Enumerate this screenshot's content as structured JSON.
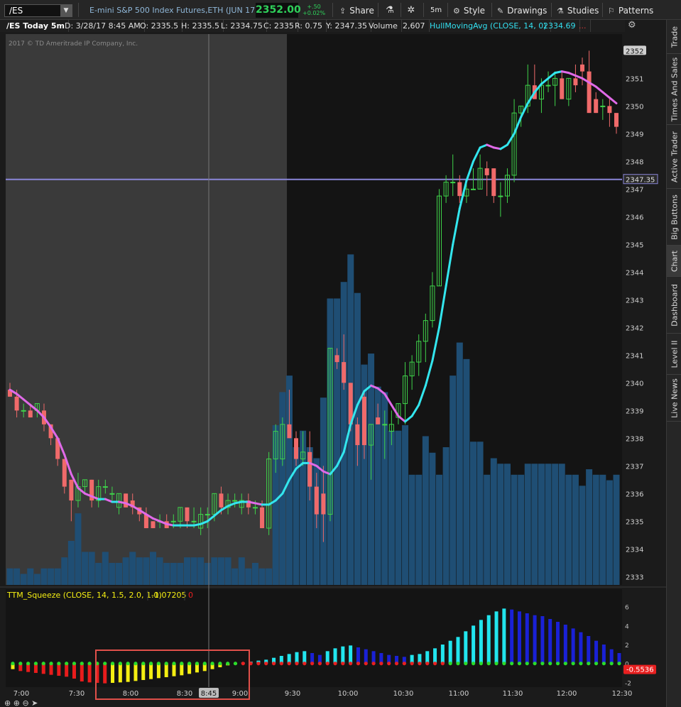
{
  "toolbar": {
    "symbol": "/ES",
    "description": "E-mini S&P 500 Index Futures,ETH (JUN 17)",
    "last_price": "2352.00",
    "change_abs": "+.50",
    "change_pct": "+0.02%",
    "share_label": "Share",
    "interval_label": "5m",
    "style_label": "Style",
    "drawings_label": "Drawings",
    "studies_label": "Studies",
    "patterns_label": "Patterns"
  },
  "infobar": {
    "title": "/ES Today 5m",
    "date": "D: 3/28/17 8:45 AM",
    "open": "O: 2335.5",
    "high": "H: 2335.5",
    "low": "L: 2334.75",
    "close": "C: 2335",
    "range": "R: 0.75",
    "y": "Y: 2347.35",
    "volume_label": "Volume",
    "volume_value": "2,607",
    "study_label": "HullMovingAvg (CLOSE, 14, 0)",
    "study_value": "2334.69",
    "dots": "..."
  },
  "watermark": "2017 © TD Ameritrade IP Company, Inc.",
  "sidebar_tabs": [
    "Trade",
    "Times And Sales",
    "Active Trader",
    "Big Buttons",
    "Chart",
    "Dashboard",
    "Level II",
    "Live News"
  ],
  "active_tab": "Chart",
  "lower_study": {
    "label": "TTM_Squeeze (CLOSE, 14, 1.5, 2.0, 1.0)",
    "value": "-1.07205",
    "extra": "0",
    "last_badge": "-0.5536"
  },
  "crosshair_time": "8:45",
  "price_badges": {
    "top": "2352",
    "horizontal_line": "2347.35"
  },
  "colors": {
    "up_candle": "#3fd34a",
    "down_candle": "#f06a6a",
    "hma_rising": "#33e6ee",
    "hma_falling": "#e06ae8",
    "volume": "#1f4e74",
    "premarket_bg": "#3a3a3a",
    "session_bg": "#141414",
    "h_line": "#8a86d8",
    "squeeze_red": "#e81c1c",
    "squeeze_yellow": "#f4ee12",
    "squeeze_cyan": "#22e5ee",
    "squeeze_blue": "#1a21d6",
    "dot_green": "#2adc2a",
    "dot_red": "#e82020",
    "highlight_box": "#e0504a"
  },
  "chart_data": [
    {
      "type": "candlestick",
      "title": "/ES Today 5m",
      "price_axis_ticks": [
        "2333",
        "2334",
        "2335",
        "2336",
        "2337",
        "2338",
        "2339",
        "2340",
        "2341",
        "2342",
        "2343",
        "2344",
        "2345",
        "2346",
        "2347",
        "2348",
        "2349",
        "2350",
        "2351",
        "2352"
      ],
      "ylim": [
        2332.7,
        2352.6
      ],
      "time_ticks": [
        "7:00",
        "7:30",
        "8:00",
        "8:30",
        "9:00",
        "9:30",
        "10:00",
        "10:30",
        "11:00",
        "11:30",
        "12:00",
        "12:30"
      ],
      "candles": [
        [
          2339.75,
          2340.0,
          2339.5,
          2339.5
        ],
        [
          2339.5,
          2339.75,
          2338.75,
          2339.0
        ],
        [
          2339.0,
          2339.25,
          2338.75,
          2339.0
        ],
        [
          2339.0,
          2339.25,
          2338.75,
          2338.75
        ],
        [
          2339.0,
          2339.25,
          2338.75,
          2339.25
        ],
        [
          2339.0,
          2339.25,
          2338.25,
          2338.5
        ],
        [
          2338.5,
          2338.5,
          2337.75,
          2338.0
        ],
        [
          2338.0,
          2338.0,
          2337.0,
          2337.25
        ],
        [
          2337.25,
          2337.25,
          2336.0,
          2336.25
        ],
        [
          2336.5,
          2336.5,
          2335.0,
          2335.75
        ],
        [
          2335.75,
          2336.75,
          2335.5,
          2336.25
        ],
        [
          2336.25,
          2336.5,
          2336.0,
          2336.5
        ],
        [
          2336.5,
          2336.5,
          2335.5,
          2335.75
        ],
        [
          2335.75,
          2336.5,
          2335.5,
          2336.25
        ],
        [
          2336.25,
          2336.5,
          2336.0,
          2336.25
        ],
        [
          2336.0,
          2336.25,
          2335.75,
          2336.0
        ],
        [
          2335.5,
          2336.0,
          2335.25,
          2336.0
        ],
        [
          2336.0,
          2336.0,
          2335.5,
          2335.5
        ],
        [
          2335.75,
          2336.0,
          2335.25,
          2335.5
        ],
        [
          2335.5,
          2335.5,
          2335.0,
          2335.25
        ],
        [
          2335.25,
          2335.5,
          2334.75,
          2334.75
        ],
        [
          2335.0,
          2335.0,
          2334.75,
          2334.75
        ],
        [
          2335.0,
          2335.25,
          2334.75,
          2335.0
        ],
        [
          2335.0,
          2335.25,
          2334.75,
          2334.75
        ],
        [
          2335.0,
          2335.25,
          2334.75,
          2335.0
        ],
        [
          2335.0,
          2335.5,
          2334.75,
          2335.5
        ],
        [
          2335.5,
          2335.5,
          2334.75,
          2335.0
        ],
        [
          2335.0,
          2335.5,
          2334.75,
          2335.0
        ],
        [
          2334.75,
          2335.5,
          2334.5,
          2335.25
        ],
        [
          2335.25,
          2335.5,
          2334.75,
          2335.25
        ],
        [
          2335.25,
          2336.0,
          2335.0,
          2336.0
        ],
        [
          2336.0,
          2336.25,
          2335.25,
          2335.5
        ],
        [
          2335.5,
          2336.0,
          2335.25,
          2335.75
        ],
        [
          2335.75,
          2336.0,
          2335.5,
          2335.75
        ],
        [
          2335.5,
          2336.0,
          2335.25,
          2335.75
        ],
        [
          2335.75,
          2336.0,
          2335.25,
          2335.5
        ],
        [
          2335.5,
          2335.75,
          2335.25,
          2335.5
        ],
        [
          2335.5,
          2335.75,
          2334.75,
          2334.75
        ],
        [
          2334.75,
          2337.5,
          2334.5,
          2337.25
        ],
        [
          2337.25,
          2338.5,
          2336.75,
          2338.25
        ],
        [
          2337.25,
          2338.75,
          2337.0,
          2338.5
        ],
        [
          2338.5,
          2339.75,
          2338.25,
          2338.0
        ],
        [
          2338.0,
          2338.25,
          2337.0,
          2337.25
        ],
        [
          2337.25,
          2338.25,
          2337.0,
          2337.5
        ],
        [
          2337.5,
          2338.25,
          2335.75,
          2336.25
        ],
        [
          2336.25,
          2336.75,
          2334.75,
          2335.25
        ],
        [
          2336.0,
          2337.0,
          2334.25,
          2335.25
        ],
        [
          2335.25,
          2341.25,
          2335.0,
          2341.25
        ],
        [
          2341.0,
          2341.25,
          2340.5,
          2340.75
        ],
        [
          2340.75,
          2341.75,
          2339.75,
          2340.0
        ],
        [
          2340.0,
          2340.0,
          2338.25,
          2338.5
        ],
        [
          2338.5,
          2338.75,
          2337.0,
          2337.75
        ],
        [
          2339.5,
          2339.75,
          2337.25,
          2337.75
        ],
        [
          2337.75,
          2338.5,
          2336.5,
          2338.5
        ],
        [
          2338.75,
          2339.25,
          2338.5,
          2338.5
        ],
        [
          2338.5,
          2339.0,
          2337.25,
          2338.5
        ],
        [
          2338.25,
          2339.0,
          2337.75,
          2338.5
        ],
        [
          2338.75,
          2339.25,
          2338.5,
          2339.25
        ],
        [
          2339.25,
          2340.75,
          2338.5,
          2340.25
        ],
        [
          2340.25,
          2341.0,
          2339.75,
          2340.75
        ],
        [
          2340.75,
          2341.75,
          2340.25,
          2341.5
        ],
        [
          2341.5,
          2342.5,
          2340.75,
          2342.25
        ],
        [
          2342.25,
          2344.0,
          2342.0,
          2343.5
        ],
        [
          2343.5,
          2347.0,
          2343.5,
          2346.75
        ],
        [
          2346.75,
          2347.5,
          2346.5,
          2347.25
        ],
        [
          2347.25,
          2348.25,
          2346.75,
          2347.25
        ],
        [
          2347.25,
          2347.5,
          2346.5,
          2346.75
        ],
        [
          2346.75,
          2347.25,
          2346.5,
          2347.0
        ],
        [
          2347.0,
          2347.75,
          2347.0,
          2347.0
        ],
        [
          2347.0,
          2348.25,
          2347.0,
          2347.75
        ],
        [
          2347.75,
          2348.0,
          2346.75,
          2347.5
        ],
        [
          2347.75,
          2347.75,
          2346.5,
          2346.75
        ],
        [
          2346.75,
          2347.25,
          2346.0,
          2346.75
        ],
        [
          2346.75,
          2347.75,
          2346.5,
          2347.5
        ],
        [
          2347.5,
          2350.25,
          2347.25,
          2349.75
        ],
        [
          2349.75,
          2350.0,
          2349.25,
          2350.0
        ],
        [
          2350.0,
          2351.5,
          2349.75,
          2350.75
        ],
        [
          2350.75,
          2351.5,
          2350.25,
          2350.25
        ],
        [
          2350.25,
          2351.0,
          2349.75,
          2350.75
        ],
        [
          2350.75,
          2351.25,
          2350.5,
          2350.75
        ],
        [
          2350.75,
          2351.25,
          2350.0,
          2351.0
        ],
        [
          2351.0,
          2351.25,
          2350.25,
          2350.25
        ],
        [
          2350.25,
          2351.0,
          2350.0,
          2351.0
        ],
        [
          2351.0,
          2351.5,
          2350.5,
          2350.75
        ],
        [
          2351.5,
          2351.75,
          2350.75,
          2351.25
        ],
        [
          2351.25,
          2352.0,
          2349.75,
          2349.75
        ],
        [
          2350.25,
          2350.5,
          2349.75,
          2349.75
        ],
        [
          2350.0,
          2350.25,
          2349.5,
          2350.0
        ],
        [
          2350.0,
          2350.25,
          2349.25,
          2349.75
        ],
        [
          2349.75,
          2349.75,
          2349.0,
          2349.25
        ]
      ],
      "volume_units_pct": [
        3,
        3,
        2,
        3,
        2,
        3,
        3,
        3,
        5,
        8,
        13,
        6,
        6,
        4,
        6,
        4,
        4,
        5,
        6,
        5,
        5,
        6,
        5,
        4,
        4,
        4,
        5,
        5,
        5,
        4,
        5,
        5,
        5,
        3,
        5,
        3,
        4,
        3,
        3,
        29,
        35,
        38,
        25,
        28,
        25,
        23,
        34,
        52,
        52,
        55,
        60,
        53,
        40,
        42,
        36,
        35,
        28,
        28,
        29,
        20,
        20,
        27,
        24,
        20,
        25,
        38,
        44,
        41,
        26,
        26,
        20,
        23,
        22,
        22,
        20,
        20,
        22,
        22,
        22,
        22,
        22,
        22,
        20,
        20,
        18,
        21,
        20,
        20,
        19,
        20
      ],
      "hma": [
        2339.75,
        2339.6,
        2339.4,
        2339.2,
        2339.0,
        2338.75,
        2338.4,
        2338.0,
        2337.4,
        2336.7,
        2336.2,
        2336.0,
        2335.9,
        2335.8,
        2335.8,
        2335.7,
        2335.7,
        2335.65,
        2335.55,
        2335.4,
        2335.25,
        2335.1,
        2335.0,
        2334.9,
        2334.85,
        2334.85,
        2334.85,
        2334.85,
        2334.9,
        2335.0,
        2335.2,
        2335.4,
        2335.55,
        2335.65,
        2335.7,
        2335.7,
        2335.65,
        2335.6,
        2335.6,
        2335.75,
        2336.0,
        2336.5,
        2336.9,
        2337.1,
        2337.1,
        2337.0,
        2336.8,
        2336.7,
        2337.0,
        2337.5,
        2338.5,
        2339.2,
        2339.7,
        2339.9,
        2339.8,
        2339.6,
        2339.2,
        2338.8,
        2338.6,
        2338.8,
        2339.2,
        2339.9,
        2340.8,
        2342.0,
        2343.5,
        2345.0,
        2346.3,
        2347.3,
        2348.0,
        2348.5,
        2348.6,
        2348.5,
        2348.45,
        2348.6,
        2349.0,
        2349.6,
        2350.1,
        2350.5,
        2350.8,
        2351.0,
        2351.2,
        2351.25,
        2351.2,
        2351.1,
        2351.0,
        2350.85,
        2350.7,
        2350.5,
        2350.3,
        2350.1
      ]
    },
    {
      "type": "bar",
      "title": "TTM_Squeeze (CLOSE, 14, 1.5, 2.0, 1.0)",
      "ylim": [
        -2.5,
        6.5
      ],
      "y_ticks": [
        "-2",
        "0",
        "2",
        "4",
        "6"
      ],
      "values": [
        -0.6,
        -0.8,
        -0.9,
        -1.0,
        -1.1,
        -1.2,
        -1.3,
        -1.4,
        -1.6,
        -1.9,
        -2.0,
        -2.05,
        -2.1,
        -2.05,
        -2.0,
        -1.95,
        -1.85,
        -1.75,
        -1.65,
        -1.55,
        -1.45,
        -1.35,
        -1.25,
        -1.1,
        -0.95,
        -0.8,
        -0.6,
        -0.4,
        -0.2,
        -0.1,
        0.1,
        0.2,
        0.3,
        0.4,
        0.6,
        0.8,
        1.0,
        1.2,
        1.3,
        1.1,
        0.9,
        1.3,
        1.6,
        1.8,
        1.9,
        1.7,
        1.5,
        1.3,
        1.1,
        0.9,
        0.8,
        0.7,
        0.9,
        1.0,
        1.3,
        1.6,
        2.0,
        2.4,
        2.8,
        3.4,
        4.0,
        4.6,
        5.1,
        5.5,
        5.8,
        5.7,
        5.5,
        5.3,
        5.1,
        5.0,
        4.7,
        4.4,
        4.1,
        3.7,
        3.3,
        2.9,
        2.4,
        2.0,
        1.5,
        1.1
      ],
      "squeeze_dots": "green_except_red_run_between_9:00_and_10:30"
    }
  ]
}
